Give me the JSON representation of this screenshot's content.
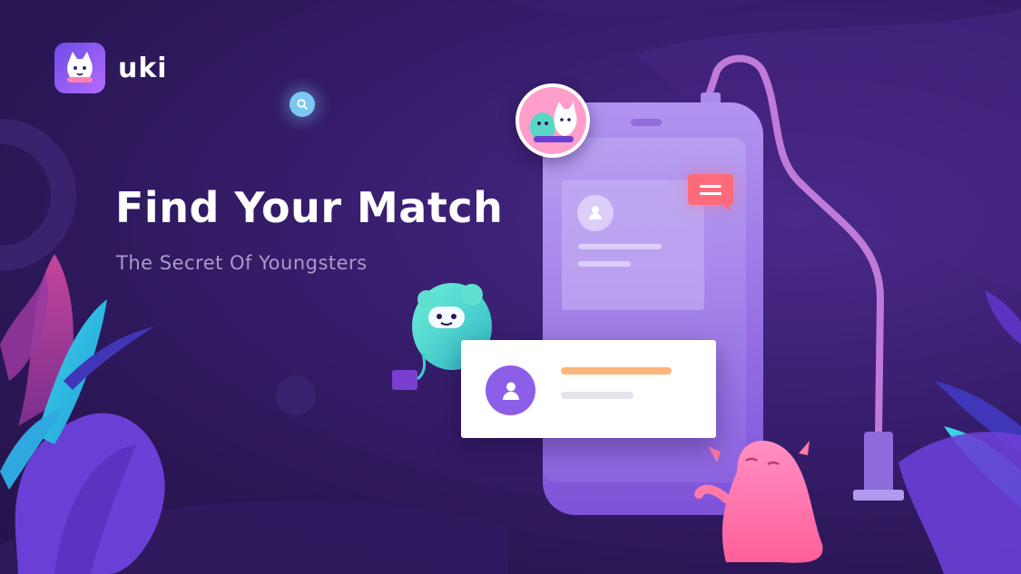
{
  "brand": {
    "name": "uki",
    "icon": "cat-mascot-icon",
    "accent": "#7b4dff"
  },
  "hero": {
    "title": "Find Your Match",
    "subtitle": "The Secret Of Youngsters"
  },
  "icons": {
    "search": "search-icon",
    "message": "message-icon",
    "user": "user-icon"
  },
  "colors": {
    "background": "#2b1757",
    "match_card_bar": "#ffb479",
    "message_bubble": "#ff6b7a",
    "phone": "#9a78ea"
  }
}
